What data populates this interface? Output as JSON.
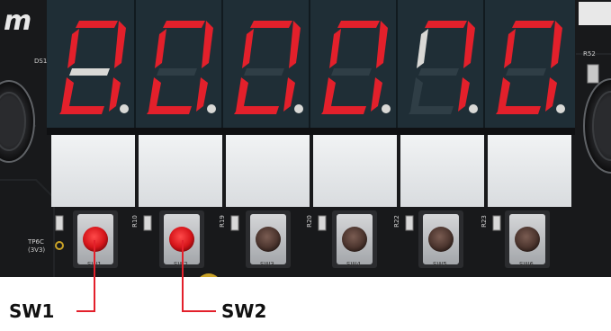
{
  "board": {
    "logo_text": "m",
    "ds_label": "DS1",
    "r52_label": "R52",
    "tp_label_1": "TP6C",
    "tp_label_2": "(3V3)",
    "resistor_labels": [
      "R10",
      "R19",
      "R20",
      "R22",
      "R23"
    ],
    "display": {
      "digit_count": 6,
      "segment_on_color": "#e3202b",
      "segment_off_color": "#2f3e46",
      "display_body_color": "#1f2e36",
      "window_color": "#e7eaec"
    },
    "switches": [
      {
        "silk": "SW1",
        "cap": "red"
      },
      {
        "silk": "SW2",
        "cap": "red"
      },
      {
        "silk": "SW3",
        "cap": "brown"
      },
      {
        "silk": "SW4",
        "cap": "brown"
      },
      {
        "silk": "SW5",
        "cap": "brown"
      },
      {
        "silk": "SW6",
        "cap": "brown"
      }
    ]
  },
  "callouts": {
    "sw1": "SW1",
    "sw2": "SW2",
    "line_color": "#e3202b"
  }
}
